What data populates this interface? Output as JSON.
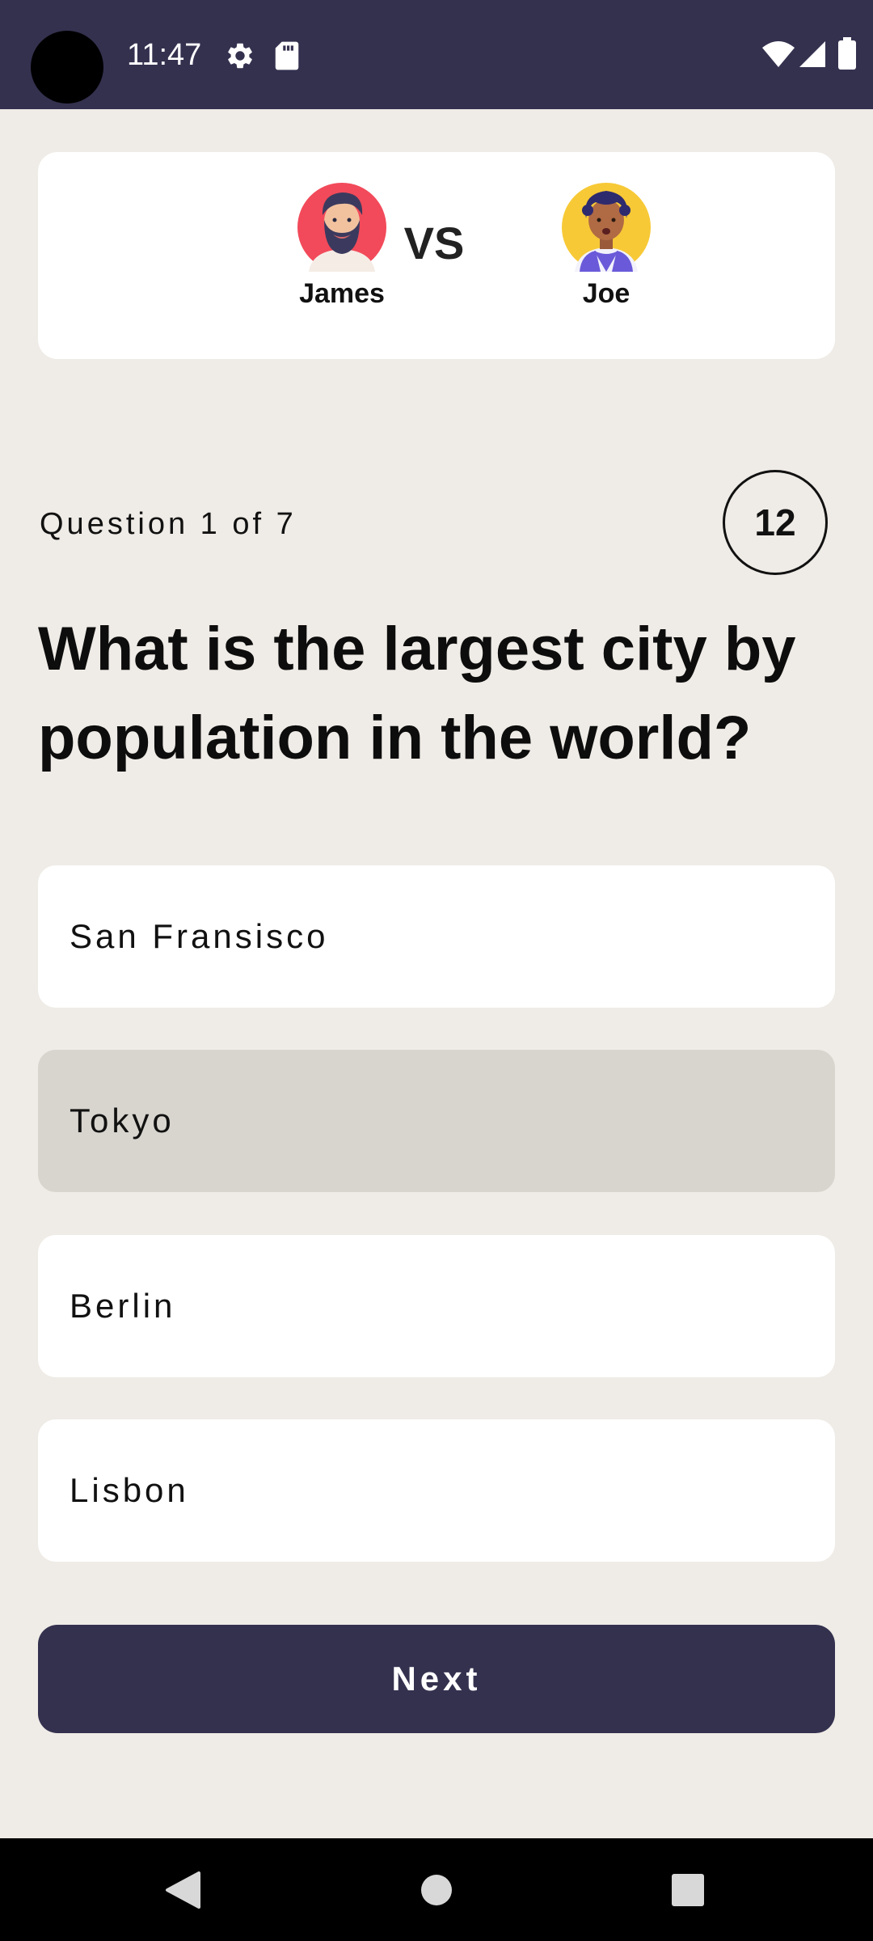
{
  "status_bar": {
    "time": "11:47",
    "icons_left": [
      "gear-icon",
      "sd-card-icon"
    ],
    "icons_right": [
      "wifi-icon",
      "signal-icon",
      "battery-icon"
    ]
  },
  "versus": {
    "player1": {
      "name": "James",
      "avatar": "bearded-man-avatar",
      "avatar_bg": "#f24a5a"
    },
    "player2": {
      "name": "Joe",
      "avatar": "curly-hair-person-avatar",
      "avatar_bg": "#f7c936"
    },
    "vs_label": "VS"
  },
  "question": {
    "counter": "Question 1 of 7",
    "timer": "12",
    "text": "What is the largest city by population in the world?"
  },
  "answers": [
    {
      "label": "San Fransisco",
      "selected": false
    },
    {
      "label": "Tokyo",
      "selected": true
    },
    {
      "label": "Berlin",
      "selected": false
    },
    {
      "label": "Lisbon",
      "selected": false
    }
  ],
  "next_button": {
    "label": "Next"
  },
  "nav_bar": {
    "icons": [
      "back-icon",
      "home-icon",
      "recents-icon"
    ]
  },
  "colors": {
    "primary": "#34314f",
    "background": "#efebe6",
    "card": "#ffffff",
    "selected": "#d8d5cf"
  }
}
